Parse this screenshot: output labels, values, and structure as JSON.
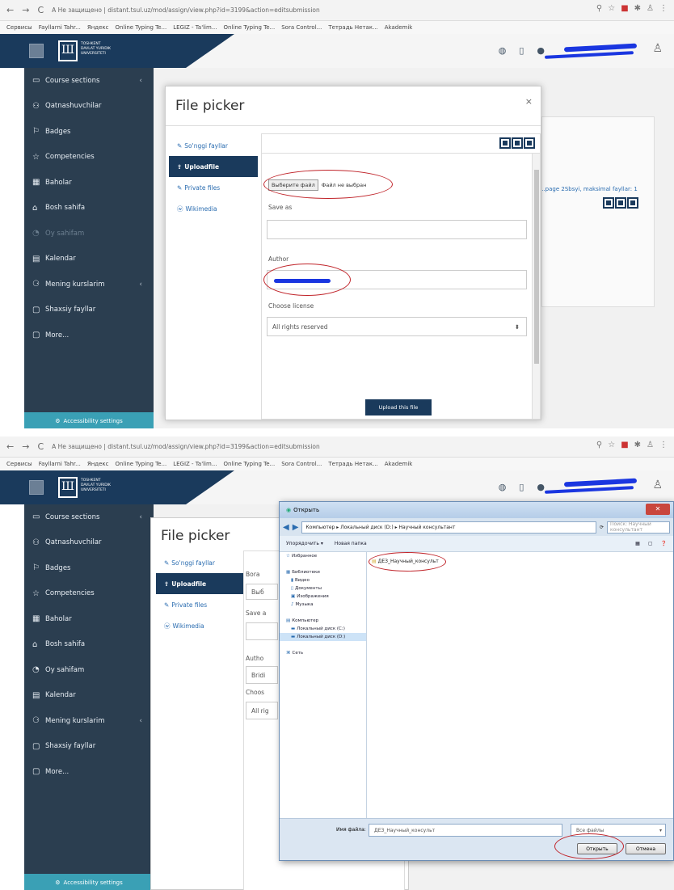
{
  "browser": {
    "url_top": "A Не защищено | distant.tsul.uz/mod/assign/view.php?id=3199&action=editsubmission",
    "url_bottom": "A Не защищено | distant.tsul.uz/mod/assign/view.php?id=3199&action=editsubmission",
    "bookmarks": [
      "Сервисы",
      "Fayllarni Tahr...",
      "Яндекс",
      "Online Typing Te...",
      "LEGIZ - Ta'lim...",
      "Online Typing Te...",
      "Sora Control...",
      "Тетрадь Нетак...",
      "Akademik"
    ]
  },
  "sidebar": {
    "items": [
      {
        "label": "Course sections",
        "icon": "▭",
        "chev": "‹"
      },
      {
        "label": "Qatnashuvchilar",
        "icon": "⚇",
        "chev": ""
      },
      {
        "label": "Badges",
        "icon": "⚐",
        "chev": ""
      },
      {
        "label": "Competencies",
        "icon": "☆",
        "chev": ""
      },
      {
        "label": "Baholar",
        "icon": "▦",
        "chev": ""
      },
      {
        "label": "Bosh sahifa",
        "icon": "⌂",
        "chev": ""
      },
      {
        "label": "Oy sahifam",
        "icon": "◔",
        "chev": ""
      },
      {
        "label": "Kalendar",
        "icon": "▤",
        "chev": ""
      },
      {
        "label": "Mening kurslarim",
        "icon": "⚆",
        "chev": "‹"
      },
      {
        "label": "Shaxsiy fayllar",
        "icon": "▢",
        "chev": ""
      },
      {
        "label": "More...",
        "icon": "▢",
        "chev": ""
      }
    ],
    "accessibility": "Accessibility settings"
  },
  "picker": {
    "title": "File picker",
    "close": "×",
    "repos": [
      {
        "label": "So'nggi fayllar",
        "icon": "✎",
        "active": false
      },
      {
        "label": "Uploadfile",
        "icon": "⇪",
        "active": true
      },
      {
        "label": "Private files",
        "icon": "✎",
        "active": false
      },
      {
        "label": "Wikimedia",
        "icon": "ⓦ",
        "active": false
      }
    ],
    "choose_file_btn": "Выберите файл",
    "no_file": "Файл не выбран",
    "save_as_label": "Save as",
    "author_label": "Author",
    "license_label": "Choose license",
    "license_value": "All rights reserved",
    "upload_btn": "Upload this file"
  },
  "bg_text_top": "...page 2Sbsyi, maksimal fayllar: 1",
  "bottom_picker_labels": {
    "repo_short": "Bora",
    "choose_short": "Выб",
    "save_short": "Save a",
    "author_short": "Autho",
    "author_val": "Bridi",
    "choose_lic_short": "Choos",
    "all_short": "All rig"
  },
  "dialog": {
    "title": "Открыть",
    "close": "✕",
    "path": "Компьютер ▸ Локальный диск (D:) ▸ Научный консультант",
    "search_placeholder": "Поиск: Научный консультант",
    "organize": "Упорядочить ▾",
    "new_folder": "Новая папка",
    "nav_items": [
      {
        "label": "Избранное",
        "icon": "☆",
        "sub": false,
        "sel": false
      },
      {
        "label": "Библиотеки",
        "icon": "▦",
        "sub": false,
        "sel": false
      },
      {
        "label": "Видео",
        "icon": "▮",
        "sub": true,
        "sel": false
      },
      {
        "label": "Документы",
        "icon": "▯",
        "sub": true,
        "sel": false
      },
      {
        "label": "Изображения",
        "icon": "▣",
        "sub": true,
        "sel": false
      },
      {
        "label": "Музыка",
        "icon": "♪",
        "sub": true,
        "sel": false
      },
      {
        "label": "Компьютер",
        "icon": "▤",
        "sub": false,
        "sel": false
      },
      {
        "label": "Локальный диск (C:)",
        "icon": "▬",
        "sub": true,
        "sel": false
      },
      {
        "label": "Локальный диск (D:)",
        "icon": "▬",
        "sub": true,
        "sel": true
      },
      {
        "label": "Сеть",
        "icon": "⌘",
        "sub": false,
        "sel": false
      }
    ],
    "file": "ДЕЗ_Научный_консульт",
    "filename_label": "Имя файла:",
    "filename_value": "ДЕЗ_Научный_консульт",
    "filter": "Все файлы",
    "open_btn": "Открыть",
    "cancel_btn": "Отмена"
  }
}
